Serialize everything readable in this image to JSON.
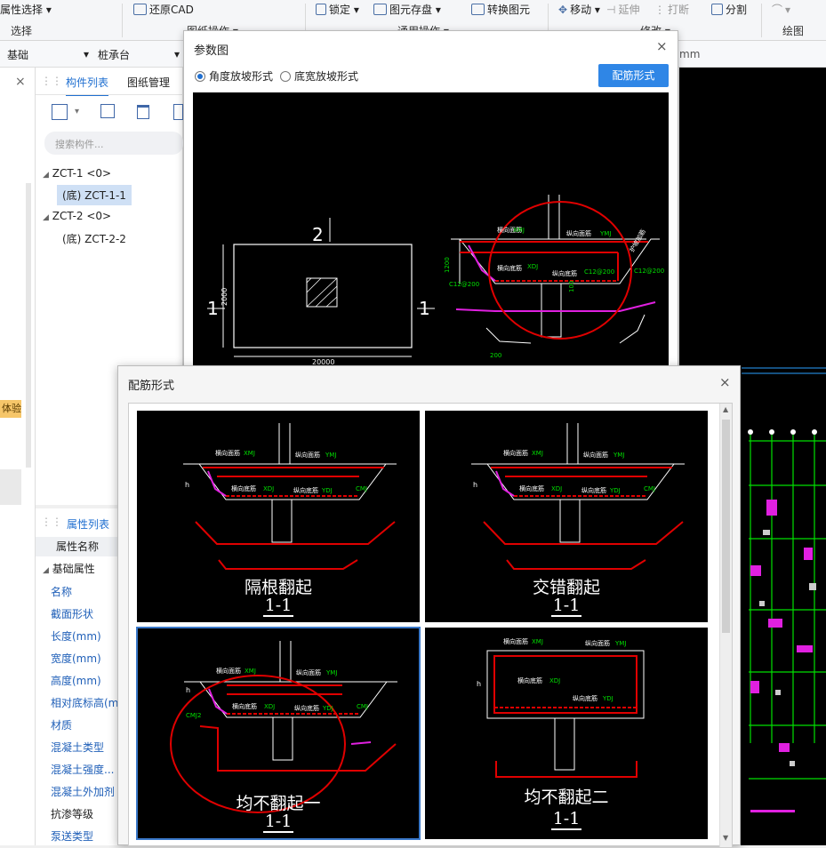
{
  "ribbon": {
    "items": [
      {
        "label": "属性选择 ▾"
      },
      {
        "label": "还原CAD"
      },
      {
        "label": "锁定 ▾"
      },
      {
        "label": "图元存盘 ▾"
      },
      {
        "label": "转换图元"
      },
      {
        "label": "移动 ▾"
      },
      {
        "label": "延伸"
      },
      {
        "label": "打断"
      },
      {
        "label": "分割"
      },
      {
        "label": "▾"
      }
    ],
    "groups": [
      "选择",
      "图纸操作 ▾",
      "通用操作 ▾",
      "修改 ▾",
      "绘图"
    ]
  },
  "bar": {
    "combo1": "基础",
    "combo2": "桩承台",
    "unit_hint": "mm"
  },
  "left_strip": {
    "close": "×",
    "badge": "体验"
  },
  "component_panel": {
    "tab_active": "构件列表",
    "tab_other": "图纸管理",
    "search_placeholder": "搜索构件...",
    "tree": [
      {
        "label": "ZCT-1 <0>",
        "toggle": "◢"
      },
      {
        "label": "(底) ZCT-1-1"
      },
      {
        "label": "ZCT-2 <0>",
        "toggle": "◢"
      },
      {
        "label": "(底) ZCT-2-2"
      }
    ]
  },
  "props_panel": {
    "tab": "属性列表",
    "header": "属性名称",
    "group": "基础属性",
    "items": [
      "名称",
      "截面形状",
      "长度(mm)",
      "宽度(mm)",
      "高度(mm)",
      "相对底标高(m",
      "材质",
      "混凝土类型",
      "混凝土强度...",
      "混凝土外加剂",
      "抗渗等级",
      "泵送类型"
    ]
  },
  "dialog1": {
    "title": "参数图",
    "close": "×",
    "radio1": "角度放坡形式",
    "radio2": "底宽放坡形式",
    "button": "配筋形式",
    "plan": {
      "mark_top": "2",
      "mark_left": "1",
      "mark_right": "1",
      "dim_bottom": "20000",
      "dim_left": "2000"
    },
    "section": {
      "t1": "横向面筋",
      "t1b": "XMJ",
      "t2": "纵向面筋",
      "t2b": "YMJ",
      "t3": "横向底筋",
      "t3b": "XDJ",
      "t4": "纵向底筋",
      "t4b": "C12@200",
      "t5": "C12@200",
      "t6": "C12@200",
      "t7": "1200",
      "t8": "200",
      "t9": "100",
      "t10": "护坡加筋"
    }
  },
  "dialog2": {
    "title": "配筋形式",
    "close": "×",
    "tiles": [
      {
        "caption": "隔根翻起",
        "sub": "1-1"
      },
      {
        "caption": "交错翻起",
        "sub": "1-1"
      },
      {
        "caption": "均不翻起一",
        "sub": "1-1"
      },
      {
        "caption": "均不翻起二",
        "sub": "1-1"
      }
    ],
    "labels": {
      "xmj": "横向面筋",
      "xmj_c": "XMJ",
      "ymj": "纵向面筋",
      "ymj_c": "YMJ",
      "xdj": "横向底筋",
      "xdj_c": "XDJ",
      "ydj": "纵向底筋",
      "ydj_c": "YDJ",
      "cmj": "CMJ",
      "cmj2": "CMJ2",
      "h": "h"
    }
  }
}
